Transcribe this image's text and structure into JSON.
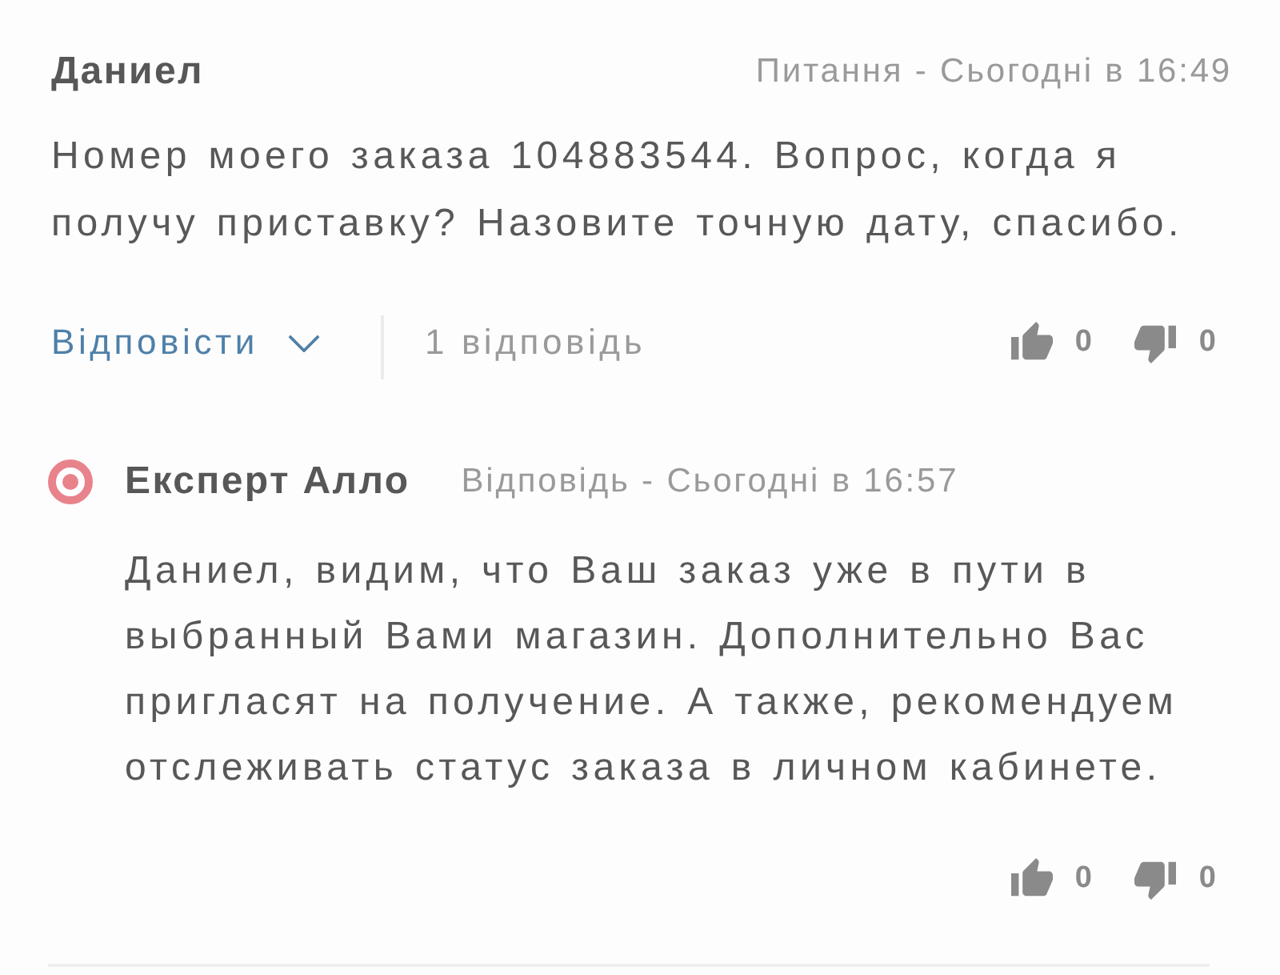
{
  "question": {
    "author": "Даниел",
    "meta": "Питання - Сьогодні в 16:49",
    "text": "Номер моего заказа 104883544. Вопрос, когда я получу приставку? Назовите точную дату, спасибо.",
    "reply_button": "Відповісти",
    "replies_count": "1 відповідь",
    "likes": "0",
    "dislikes": "0"
  },
  "answers": [
    {
      "author": "Експерт Алло",
      "meta": "Відповідь - Сьогодні в 16:57",
      "text": "Даниел, видим, что Ваш заказ уже в пути в выбранный Вами магазин. Дополнительно Вас пригласят на получение. А также, рекомендуем отслеживать статус заказа в личном кабинете.",
      "likes": "0",
      "dislikes": "0"
    }
  ]
}
